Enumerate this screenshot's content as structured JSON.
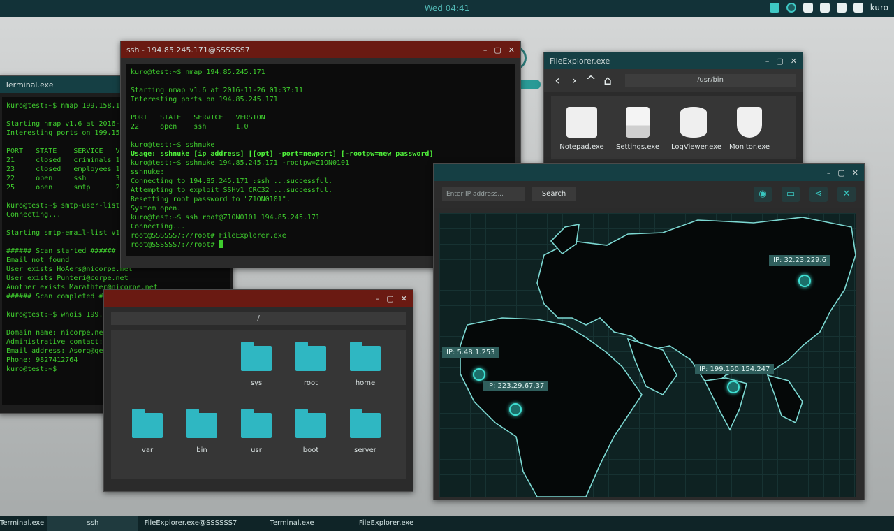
{
  "topbar": {
    "clock": "Wed 04:41",
    "user": "kuro"
  },
  "terminal_main": {
    "title": "ssh - 194.85.245.171@SSSSSS7",
    "lines": [
      "kuro@test:~$ nmap 194.85.245.171",
      "",
      "Starting nmap v1.6 at 2016-11-26 01:37:11",
      "Interesting ports on 194.85.245.171",
      "",
      "PORT   STATE   SERVICE   VERSION",
      "22     open    ssh       1.0",
      "",
      "kuro@test:~$ sshnuke",
      "Usage: sshnuke [ip address] [[opt] -port=newport] [-rootpw=new password]",
      "kuro@test:~$ sshnuke 194.85.245.171 -rootpw=Z1ON0101",
      "sshnuke:",
      "Connecting to 194.85.245.171 :ssh ...successful.",
      "Attempting to exploit SSHv1 CRC32 ...successful.",
      "Resetting root password to \"Z1ON0101\".",
      "System open.",
      "kuro@test:~$ ssh root@Z1ON0101 194.85.245.171",
      "Connecting...",
      "root@SSSSSS7://root# FileExplorer.exe",
      "root@SSSSSS7://root# "
    ]
  },
  "terminal_left": {
    "title": "Terminal.exe",
    "lines": [
      "kuro@test:~$ nmap 199.158.134.247",
      "",
      "Starting nmap v1.6 at 2016-11-26",
      "Interesting ports on 199.158.134.247",
      "",
      "PORT   STATE    SERVICE   VERSION",
      "21     closed   criminals 1.0",
      "23     closed   employees 1.0",
      "22     open     ssh       3.0",
      "25     open     smtp      2.9",
      "",
      "kuro@test:~$ smtp-user-list 199",
      "Connecting...",
      "",
      "Starting smtp-email-list v1.0",
      "",
      "###### Scan started ######",
      "Email not found",
      "User exists HoAers@nicorpe.net",
      "User exists Punteri@corpe.net",
      "Another exists Marathter@nicorpe.net",
      "###### Scan completed ######",
      "",
      "kuro@test:~$ whois 199.158.134.247",
      "",
      "Domain name: nicorpe.net",
      "Administrative contact: Marley Asorg",
      "Email address: Asorg@genome.net",
      "Phone: 9827412764",
      "kuro@test:~$"
    ]
  },
  "file_explorer": {
    "title": "FileExplorer.exe",
    "path": "/usr/bin",
    "apps": [
      {
        "label": "Notepad.exe",
        "icon": "notepad-icon"
      },
      {
        "label": "Settings.exe",
        "icon": "document-icon"
      },
      {
        "label": "LogViewer.exe",
        "icon": "database-icon"
      },
      {
        "label": "Monitor.exe",
        "icon": "shield-icon"
      }
    ]
  },
  "folders_window": {
    "path": "/",
    "folders": [
      {
        "label": "sys"
      },
      {
        "label": "root"
      },
      {
        "label": "home"
      },
      {
        "label": "var"
      },
      {
        "label": "bin"
      },
      {
        "label": "usr"
      },
      {
        "label": "boot"
      },
      {
        "label": "server"
      }
    ]
  },
  "map_window": {
    "input_placeholder": "Enter IP address...",
    "search_label": "Search",
    "markers": [
      {
        "label": "IP: 32.23.229.6"
      },
      {
        "label": "IP: 5.48.1.253"
      },
      {
        "label": "IP: 223.29.67.37"
      },
      {
        "label": "IP: 199.150.154.247"
      }
    ]
  },
  "taskbar": {
    "items": [
      {
        "label": "Terminal.exe"
      },
      {
        "label": "ssh"
      },
      {
        "label": "FileExplorer.exe@SSSSSS7"
      },
      {
        "label": "Terminal.exe"
      },
      {
        "label": "FileExplorer.exe"
      }
    ]
  },
  "colors": {
    "accent": "#3ec8c4",
    "terminal_text": "#3fcd2e",
    "titlebar_red": "#6a1a12",
    "panel_dark": "#2b2b2b"
  }
}
